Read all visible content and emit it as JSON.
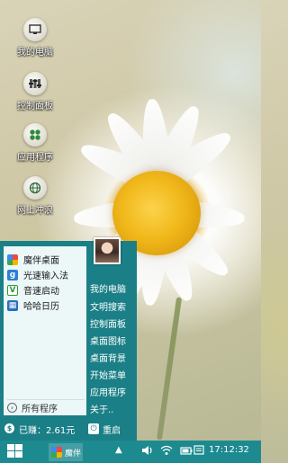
{
  "desktop_icons": [
    {
      "label": "我的电脑",
      "icon": "monitor-icon"
    },
    {
      "label": "控制面板",
      "icon": "control-panel-icon"
    },
    {
      "label": "应用程序",
      "icon": "apps-grid-icon"
    },
    {
      "label": "网上冲浪",
      "icon": "globe-icon"
    }
  ],
  "start_menu": {
    "programs": [
      {
        "label": "魔伴桌面",
        "icon": "mobanzhuomian-icon",
        "color": "#3aa0e0"
      },
      {
        "label": "光速输入法",
        "icon": "input-method-icon",
        "color": "#2b7fd4"
      },
      {
        "label": "音速启动",
        "icon": "launcher-icon",
        "color": "#2e9b3c"
      },
      {
        "label": "哈哈日历",
        "icon": "calendar-icon",
        "color": "#2a6fc2"
      }
    ],
    "all_programs": "所有程序",
    "right_items": [
      "我的电脑",
      "文明搜索",
      "控制面板",
      "桌面图标",
      "桌面背景",
      "开始菜单",
      "应用程序",
      "关于.."
    ],
    "earned": "已赚：2.61元",
    "restart": "重启"
  },
  "taskbar": {
    "app_label": "魔伴",
    "clock": "17:12:32",
    "tray_icons": [
      "caret-up-icon",
      "volume-icon",
      "wifi-icon",
      "battery-icon",
      "notification-icon"
    ]
  },
  "colors": {
    "accent": "#1a7f86",
    "taskbar": "#1d8a90",
    "panel": "#ecf7f8"
  }
}
